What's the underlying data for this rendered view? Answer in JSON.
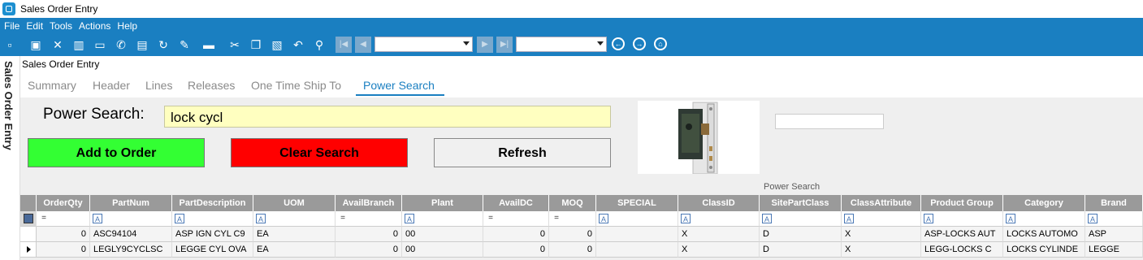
{
  "window": {
    "title": "Sales Order Entry"
  },
  "menu": [
    "File",
    "Edit",
    "Tools",
    "Actions",
    "Help"
  ],
  "side_tab": "Sales Order Entry",
  "form_title": "Sales Order Entry",
  "tabs": [
    "Summary",
    "Header",
    "Lines",
    "Releases",
    "One Time Ship To",
    "Power Search"
  ],
  "active_tab": "Power Search",
  "power_search": {
    "label": "Power Search:",
    "value": "lock cycl",
    "add_label": "Add to Order",
    "clear_label": "Clear Search",
    "refresh_label": "Refresh"
  },
  "grid": {
    "title": "Power Search",
    "columns": [
      "OrderQty",
      "PartNum",
      "PartDescription",
      "UOM",
      "AvailBranch",
      "Plant",
      "AvailDC",
      "MOQ",
      "SPECIAL",
      "ClassID",
      "SitePartClass",
      "ClassAttribute",
      "Product Group",
      "Category",
      "Brand"
    ],
    "rows": [
      [
        "0",
        "ASC94104",
        "ASP IGN CYL C9",
        "EA",
        "0",
        "00",
        "0",
        "0",
        "",
        "X",
        "D",
        "X",
        "ASP-LOCKS AUT",
        "LOCKS AUTOMO",
        "ASP"
      ],
      [
        "0",
        "LEGLY9CYCLSC",
        "LEGGE CYL OVA",
        "EA",
        "0",
        "00",
        "0",
        "0",
        "",
        "X",
        "D",
        "X",
        "LEGG-LOCKS C",
        "LOCKS CYLINDE",
        "LEGGE"
      ]
    ]
  },
  "colors": {
    "accent": "#1a7fc1",
    "add_button": "#33ff33",
    "clear_button": "#ff0000",
    "search_bg": "#ffffc0",
    "header_bg": "#9a9a9a"
  }
}
